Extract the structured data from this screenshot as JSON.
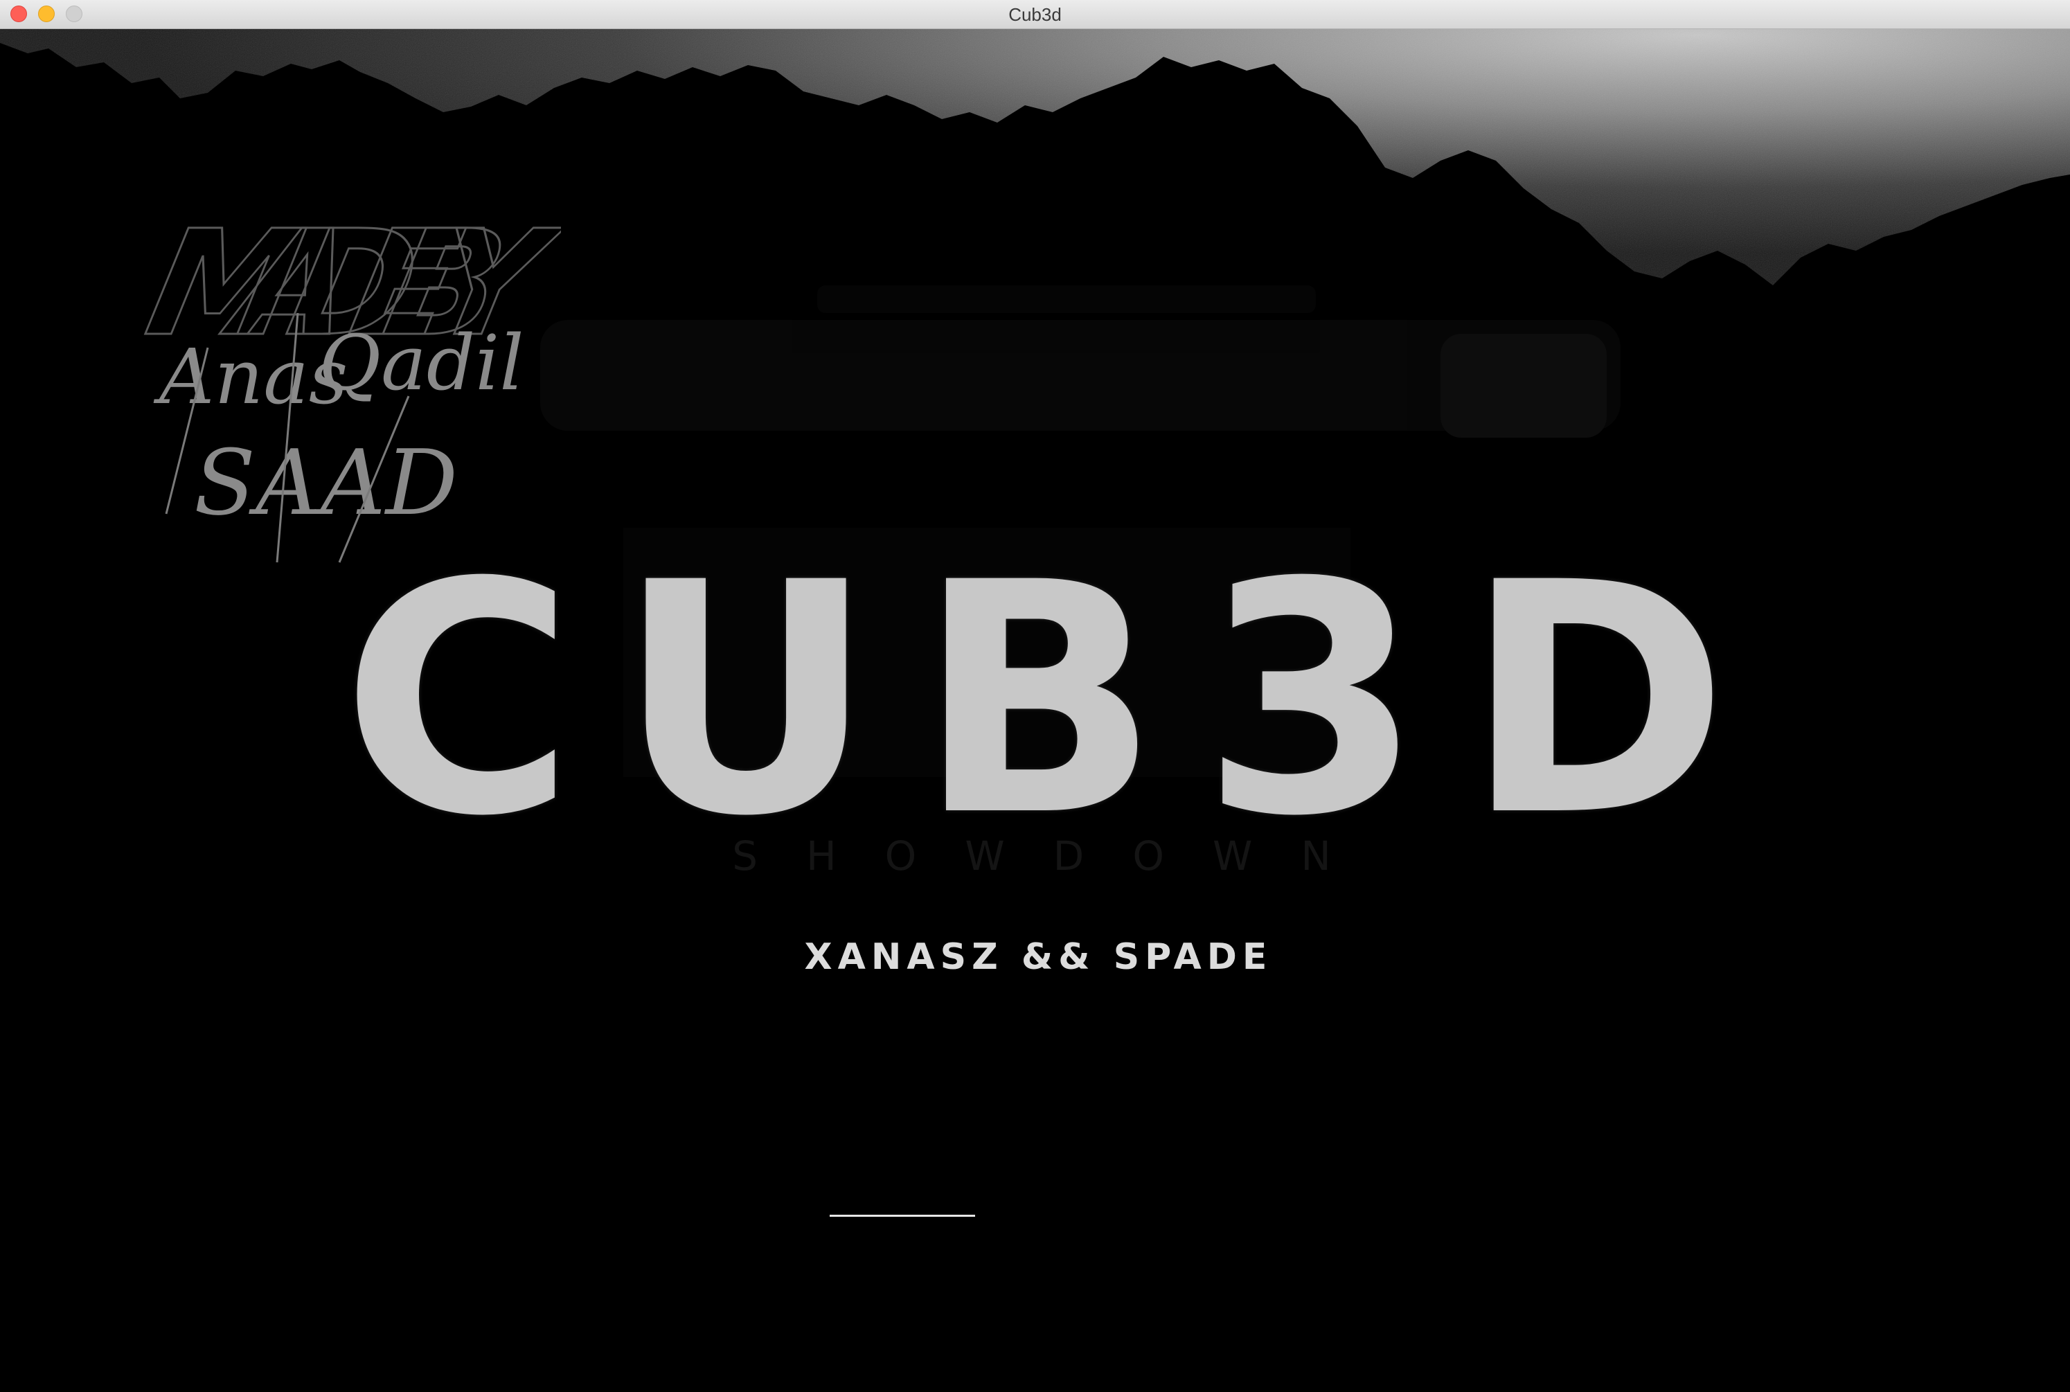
{
  "window": {
    "title": "Cub3d"
  },
  "credits_art": {
    "heading": "MADE BY",
    "names": [
      "Anas",
      "Qadil",
      "SAAD"
    ]
  },
  "logo": {
    "title": "CUB3D",
    "ghost_subtitle": "SHOWDOWN"
  },
  "credits_line": "XANASZ && SPADE",
  "colors": {
    "background": "#000000",
    "logo": "#c8c8c8",
    "sky": "#9a9a9a",
    "mountain": "#000000"
  },
  "icons": [
    "close-window-icon",
    "minimize-window-icon",
    "zoom-window-icon"
  ]
}
